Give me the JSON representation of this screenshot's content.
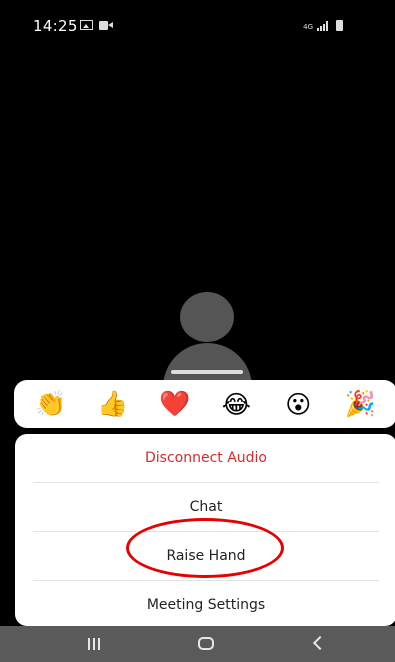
{
  "status_bar": {
    "time": "14:25",
    "network_label": "4G"
  },
  "reactions": [
    {
      "name": "clapping-hands",
      "glyph": "👏"
    },
    {
      "name": "thumbs-up",
      "glyph": "👍"
    },
    {
      "name": "heart",
      "glyph": "❤️"
    },
    {
      "name": "tears-of-joy",
      "glyph": "😂"
    },
    {
      "name": "surprised",
      "glyph": "😮"
    },
    {
      "name": "party-popper",
      "glyph": "🎉"
    }
  ],
  "menu": {
    "disconnect_audio": "Disconnect Audio",
    "chat": "Chat",
    "raise_hand": "Raise Hand",
    "meeting_settings": "Meeting Settings"
  },
  "colors": {
    "danger": "#d62b2b",
    "highlight_ring": "#e60000",
    "background": "#000000",
    "nav_bar": "#5a5a5a"
  },
  "icons": {
    "status_left": [
      "gallery-icon",
      "video-icon"
    ],
    "status_right": [
      "signal-icon",
      "battery-icon"
    ],
    "nav": [
      "recents-icon",
      "home-icon",
      "back-icon"
    ]
  }
}
